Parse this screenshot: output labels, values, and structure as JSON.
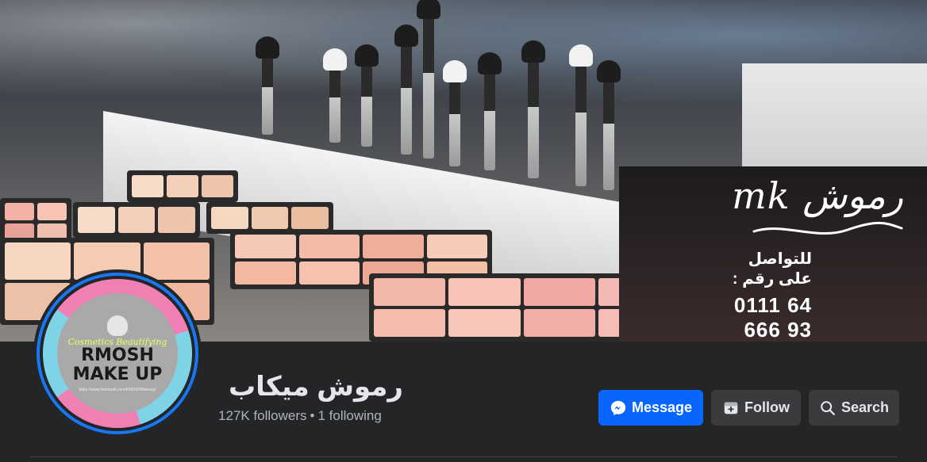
{
  "cover": {
    "brand_mark": "mk رموش",
    "contact_label": "للتواصل على رقم :",
    "contact_phone": "0111 64 666 93"
  },
  "avatar": {
    "script_text": "Cosmetics Beautifying",
    "name_line1": "RMOSH",
    "name_line2": "MAKE UP",
    "url_text": "https://www.facebook.com/RMOSHMakeup/"
  },
  "page": {
    "title": "رموش ميكاب",
    "followers": "127K followers",
    "separator": "•",
    "following": "1 following"
  },
  "actions": {
    "message_label": "Message",
    "follow_label": "Follow",
    "search_label": "Search"
  },
  "icons": {
    "message": "messenger-icon",
    "follow": "follow-add-icon",
    "search": "search-icon"
  },
  "colors": {
    "primary": "#0866ff",
    "secondary_button": "#3a3b3c",
    "background": "#242526",
    "text_primary": "#e4e6eb",
    "text_secondary": "#b0b3b8",
    "avatar_ring": "#1877f2"
  }
}
